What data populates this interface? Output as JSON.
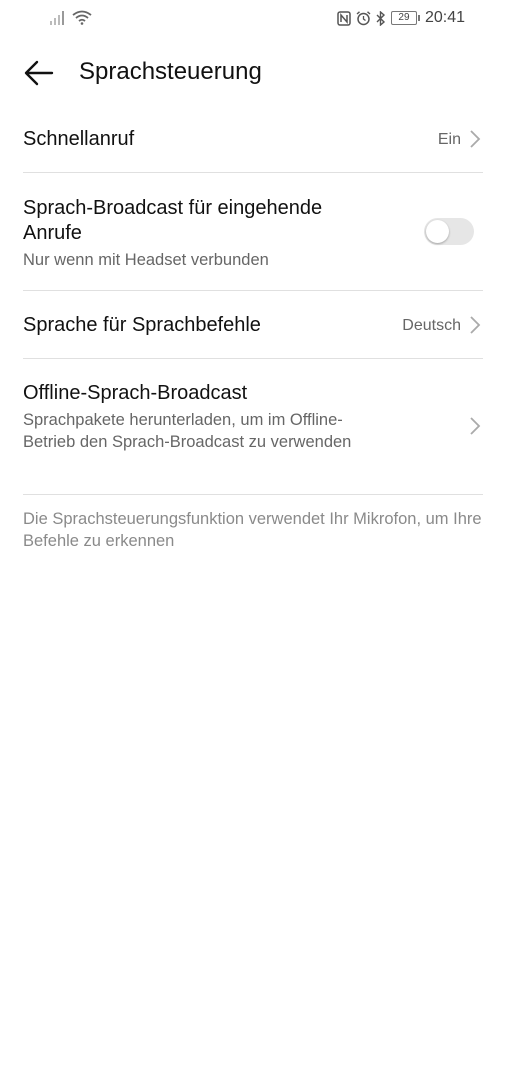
{
  "status_bar": {
    "time": "20:41",
    "battery_level": "29",
    "left_icons": [
      "signal-icon",
      "wifi-icon"
    ],
    "right_icons": [
      "nfc-icon",
      "alarm-icon",
      "bluetooth-icon",
      "battery-icon"
    ]
  },
  "header": {
    "title": "Sprachsteuerung"
  },
  "settings": {
    "quick_call": {
      "title": "Schnellanruf",
      "value": "Ein"
    },
    "broadcast_incoming": {
      "title": "Sprach-Broadcast für eingehende Anrufe",
      "subtitle": "Nur wenn mit Headset verbunden",
      "enabled": false
    },
    "command_language": {
      "title": "Sprache für Sprachbefehle",
      "value": "Deutsch"
    },
    "offline_broadcast": {
      "title": "Offline-Sprach-Broadcast",
      "subtitle": "Sprachpakete herunterladen, um im Offline-Betrieb den Sprach-Broadcast zu verwenden"
    }
  },
  "footnote": "Die Sprachsteuerungsfunktion verwendet Ihr Mikrofon, um Ihre Befehle zu erkennen"
}
